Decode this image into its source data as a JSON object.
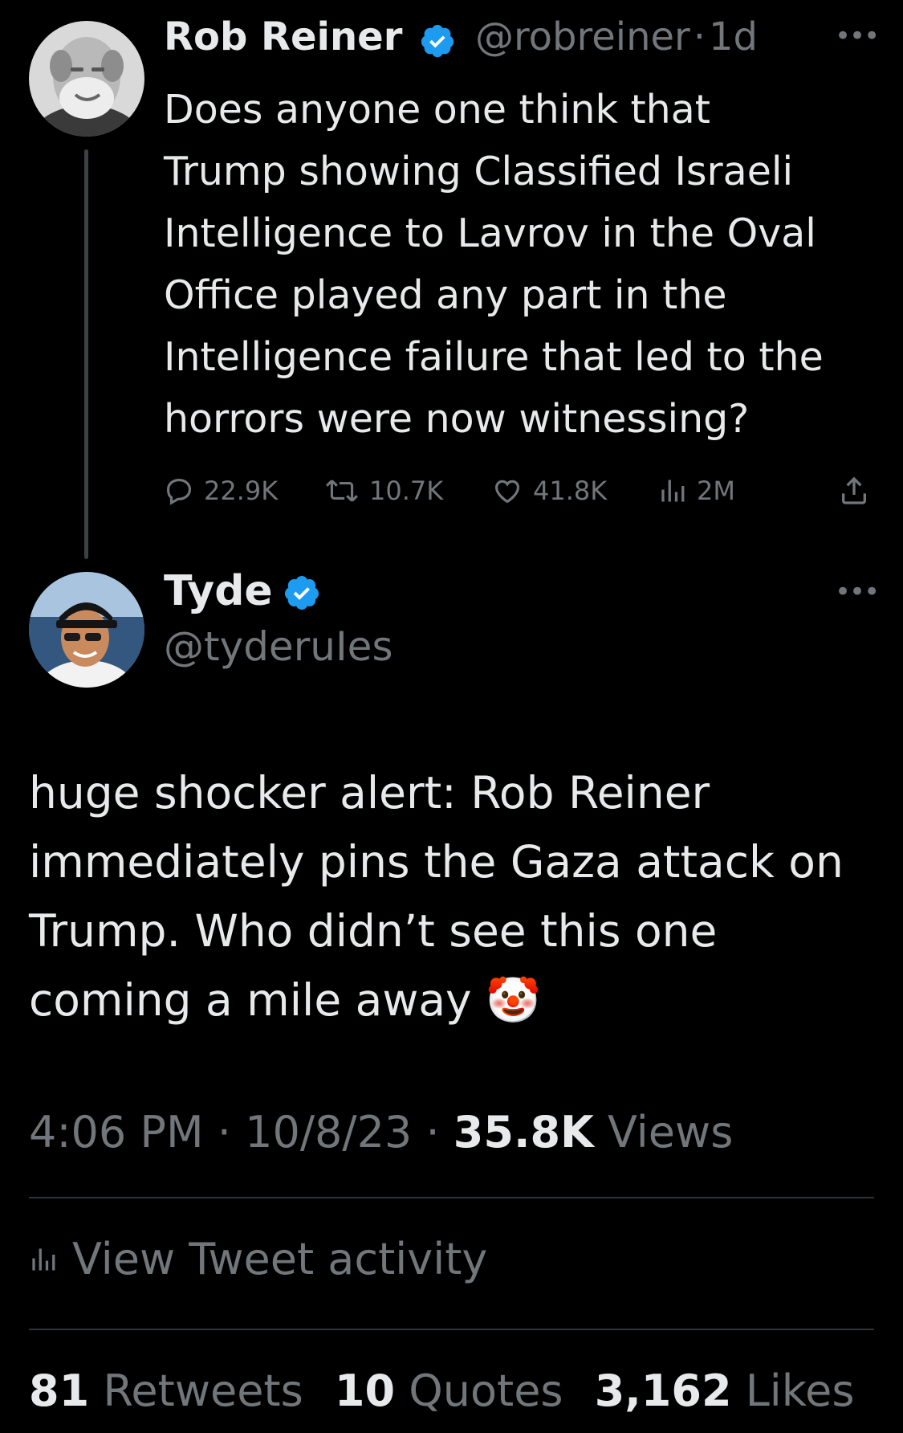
{
  "reply_to": {
    "name": "Rob Reiner",
    "handle": "@robreiner",
    "separator": "·",
    "time_ago": "1d",
    "text": "Does anyone one think that\nTrump showing Classified Israeli\nIntelligence to Lavrov in the Oval\nOffice played any part in the\nIntelligence failure that led to the\nhorrors were now witnessing?",
    "actions": {
      "replies": "22.9K",
      "retweets": "10.7K",
      "likes": "41.8K",
      "views": "2M"
    }
  },
  "main_tweet": {
    "name": "Tyde",
    "handle": "@tyderuIes",
    "text": "huge shocker alert:  Rob Reiner\nimmediately pins the Gaza attack on\nTrump.  Who didn’t see this one\ncoming a mile away",
    "emoji": "🤡",
    "time": "4:06 PM",
    "date": "10/8/23",
    "separator": "·",
    "views_count": "35.8K",
    "views_label": "Views",
    "activity_label": "View Tweet activity",
    "stats": {
      "retweets_count": "81",
      "retweets_label": "Retweets",
      "quotes_count": "10",
      "quotes_label": "Quotes",
      "likes_count": "3,162",
      "likes_label": "Likes"
    }
  },
  "colors": {
    "background": "#000000",
    "text": "#e7e9ea",
    "muted": "#71767b",
    "verified": "#1d9bf0",
    "divider": "#2f3336"
  },
  "icons": [
    "more-icon",
    "verified-icon",
    "reply-icon",
    "retweet-icon",
    "like-icon",
    "views-icon",
    "share-icon",
    "analytics-icon"
  ]
}
